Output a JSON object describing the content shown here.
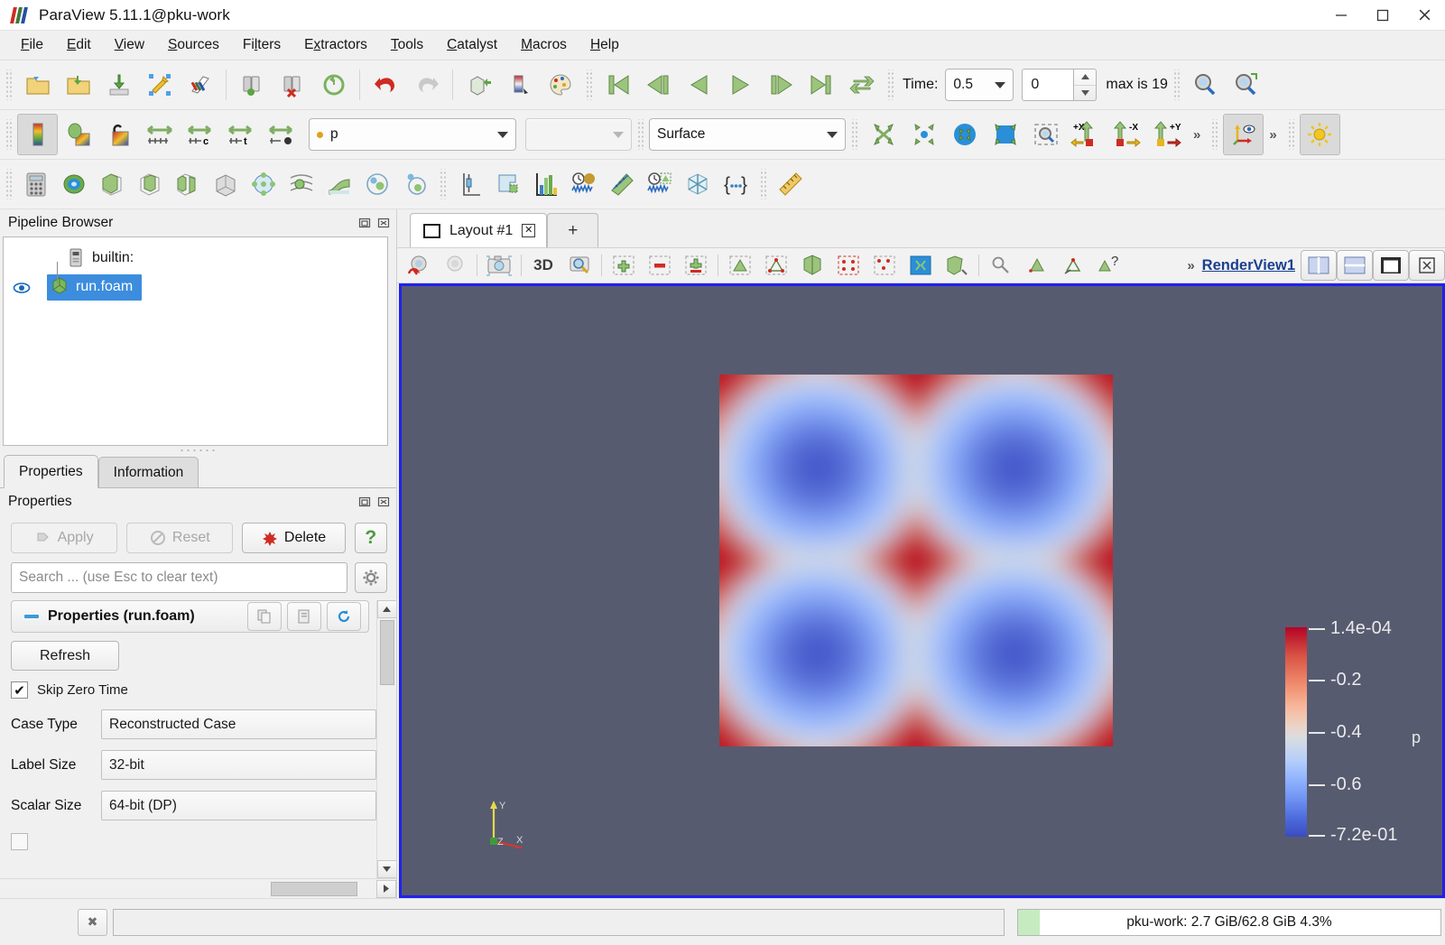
{
  "window": {
    "title": "ParaView 5.11.1@pku-work",
    "controls": {
      "minimize": "–",
      "maximize": "▢",
      "close": "✕"
    }
  },
  "menubar": {
    "items": [
      {
        "label": "File"
      },
      {
        "label": "Edit"
      },
      {
        "label": "View"
      },
      {
        "label": "Sources"
      },
      {
        "label": "Filters"
      },
      {
        "label": "Extractors"
      },
      {
        "label": "Tools"
      },
      {
        "label": "Catalyst"
      },
      {
        "label": "Macros"
      },
      {
        "label": "Help"
      }
    ]
  },
  "toolbar_main": {
    "icons": [
      "open-file-icon",
      "open-recent-icon",
      "save-data-icon",
      "save-screenshot-icon",
      "save-state-icon",
      "connect-server-icon",
      "disconnect-server-icon",
      "reset-session-icon",
      "undo-icon",
      "redo-icon",
      "camera-undo-icon",
      "scalar-bar-icon",
      "edit-color-map-icon"
    ],
    "vcr": [
      "first-frame-icon",
      "previous-frame-icon",
      "play-reverse-icon",
      "play-icon",
      "next-frame-icon",
      "last-frame-icon",
      "loop-icon"
    ],
    "time_label": "Time:",
    "time_value": "0.5",
    "frame_value": "0",
    "max_label": "max is 19",
    "trailing_icons": [
      "zoom-to-data-icon",
      "zoom-closest-icon"
    ]
  },
  "toolbar_representation": {
    "icons": [
      "color-map-icon",
      "rescale-to-data-icon",
      "rescale-custom-icon",
      "rescale-range-icon",
      "rescale-visible-icon",
      "rescale-time-icon",
      "rescale-all-icon"
    ],
    "array_selector": {
      "value": "p",
      "type": "point-data"
    },
    "component_selector": {
      "value": ""
    },
    "representation_selector": {
      "value": "Surface"
    },
    "view_icons": [
      "reset-camera-icon",
      "zoom-to-box-icon",
      "zoom-to-data-icon",
      "adjust-camera-icon",
      "rubber-band-icon",
      "plus-x-icon",
      "minus-x-icon",
      "plus-y-icon"
    ],
    "overflow": "»",
    "axes_toggle": "show-orientation-axes-icon",
    "light_toggle": "edit-light-kit-icon"
  },
  "toolbar_filters": {
    "icons": [
      "calculator-icon",
      "contour-icon",
      "clip-icon",
      "slice-icon",
      "threshold-icon",
      "extract-subset-icon",
      "glyph-icon",
      "stream-tracer-icon",
      "warp-icon",
      "group-datasets-icon",
      "extract-level-icon",
      "plot-over-line-icon",
      "extract-selection-icon",
      "histogram-icon",
      "plot-data-over-time-icon",
      "plot-on-sorted-lines-icon",
      "plot-selection-over-time-icon",
      "axis-aligned-slice-icon",
      "python-calculator-icon",
      "ruler-icon"
    ]
  },
  "pipeline": {
    "title": "Pipeline Browser",
    "dock_buttons": [
      "undock-icon",
      "close-icon"
    ],
    "items": [
      {
        "label": "builtin:",
        "icon": "server-icon",
        "selected": false,
        "visible_toggle": false
      },
      {
        "label": "run.foam",
        "icon": "source-icon",
        "selected": true,
        "visible_toggle": true
      }
    ]
  },
  "properties_panel": {
    "tabs": [
      {
        "label": "Properties",
        "active": true
      },
      {
        "label": "Information",
        "active": false
      }
    ],
    "dock_title": "Properties",
    "dock_buttons": [
      "undock-icon",
      "close-icon"
    ],
    "buttons": {
      "apply": "Apply",
      "reset": "Reset",
      "delete": "Delete",
      "help": "?"
    },
    "search_placeholder": "Search ... (use Esc to clear text)",
    "gear": "advanced-properties-icon",
    "group_header": "Properties (run.foam)",
    "group_buttons": [
      "copy-icon",
      "paste-icon",
      "restore-defaults-icon"
    ],
    "refresh_button": "Refresh",
    "skip_zero_time": {
      "label": "Skip Zero Time",
      "checked": true,
      "check_glyph": "✔"
    },
    "fields": [
      {
        "label": "Case Type",
        "value": "Reconstructed Case"
      },
      {
        "label": "Label Size",
        "value": "32-bit"
      },
      {
        "label": "Scalar Size",
        "value": "64-bit (DP)"
      }
    ]
  },
  "layout": {
    "tab_label": "Layout #1",
    "tab_close": "✕",
    "add_tab": "+",
    "view_toolbar_icons": [
      "undo-camera-icon",
      "redo-camera-icon",
      "capture-screenshot-icon"
    ],
    "mode_3d": "3D",
    "toolbar_icons_2": [
      "zoom-to-box-icon",
      "add-selection-icon",
      "subtract-selection-icon",
      "toggle-selection-icon",
      "select-points-icon",
      "select-cells-icon",
      "frustum-select-icon",
      "block-select-icon",
      "interactive-select-icon",
      "hover-points-icon",
      "hover-cells-icon",
      "select-custom-icon",
      "zoom-select-icon",
      "point-select-icon",
      "select-help-icon"
    ],
    "overflow": "»",
    "render_view_name": "RenderView1",
    "split_buttons": [
      "split-horizontal-icon",
      "split-vertical-icon",
      "maximize-icon",
      "close-view-icon"
    ]
  },
  "render_view": {
    "background_color": "#575b70",
    "border_color": "#2020ee",
    "orientation_axes": {
      "x": "X",
      "y": "Y",
      "z": "Z"
    },
    "color_legend": {
      "title": "p",
      "ticks": [
        "1.4e-04",
        "-0.2",
        "-0.4",
        "-0.6",
        "-7.2e-01"
      ],
      "colormap": "Cool to Warm",
      "max": "1.4e-04",
      "min": "-7.2e-01"
    }
  },
  "status_bar": {
    "cancel": "✖",
    "progress": "",
    "memory_text": "pku-work: 2.7 GiB/62.8 GiB 4.3%"
  },
  "chart_data": {
    "type": "heatmap",
    "title": "p",
    "description": "OpenFOAM pressure field, 2D periodic Taylor-Green-like vortex pattern",
    "colormap": "Cool to Warm (blue-white-red)",
    "vmin": -0.72,
    "vmax": 0.00014,
    "tick_labels": [
      "1.4e-04",
      "-0.2",
      "-0.4",
      "-0.6",
      "-7.2e-01"
    ],
    "tick_values": [
      0.00014,
      -0.2,
      -0.4,
      -0.6,
      -0.72
    ],
    "pattern": "cos(2πx)cos(2πy) checkerboard with 2x2 blue minima and red maxima at centers/edges"
  }
}
